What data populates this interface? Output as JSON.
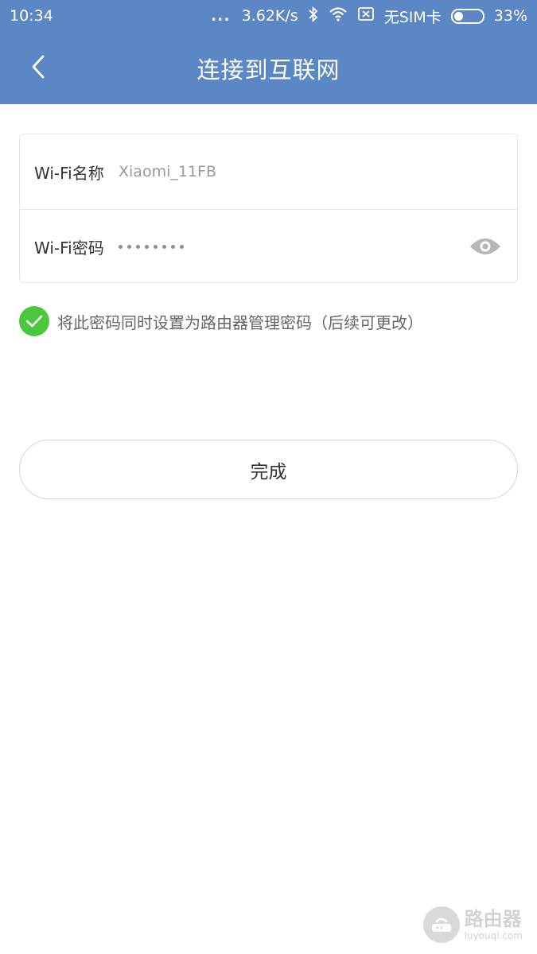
{
  "status_bar": {
    "time": "10:34",
    "dots": "...",
    "speed": "3.62K/s",
    "sim": "无SIM卡",
    "battery": "33%",
    "battery_level": 0.33
  },
  "header": {
    "title": "连接到互联网"
  },
  "form": {
    "ssid_label": "Wi-Fi名称",
    "ssid_value": "Xiaomi_11FB",
    "password_label": "Wi-Fi密码",
    "password_mask_count": 8
  },
  "checkbox": {
    "checked": true,
    "label": "将此密码同时设置为路由器管理密码（后续可更改）"
  },
  "actions": {
    "done_label": "完成"
  },
  "watermark": {
    "title": "路由器",
    "subtitle": "luyouqi.com"
  },
  "colors": {
    "header_bg": "#5b87c5",
    "check_green": "#4cc63a"
  },
  "icons": {
    "back": "chevron-left-icon",
    "bluetooth": "bluetooth-icon",
    "wifi": "wifi-icon",
    "sim": "no-sim-icon",
    "battery": "battery-icon",
    "eye": "eye-icon",
    "check": "check-icon"
  }
}
